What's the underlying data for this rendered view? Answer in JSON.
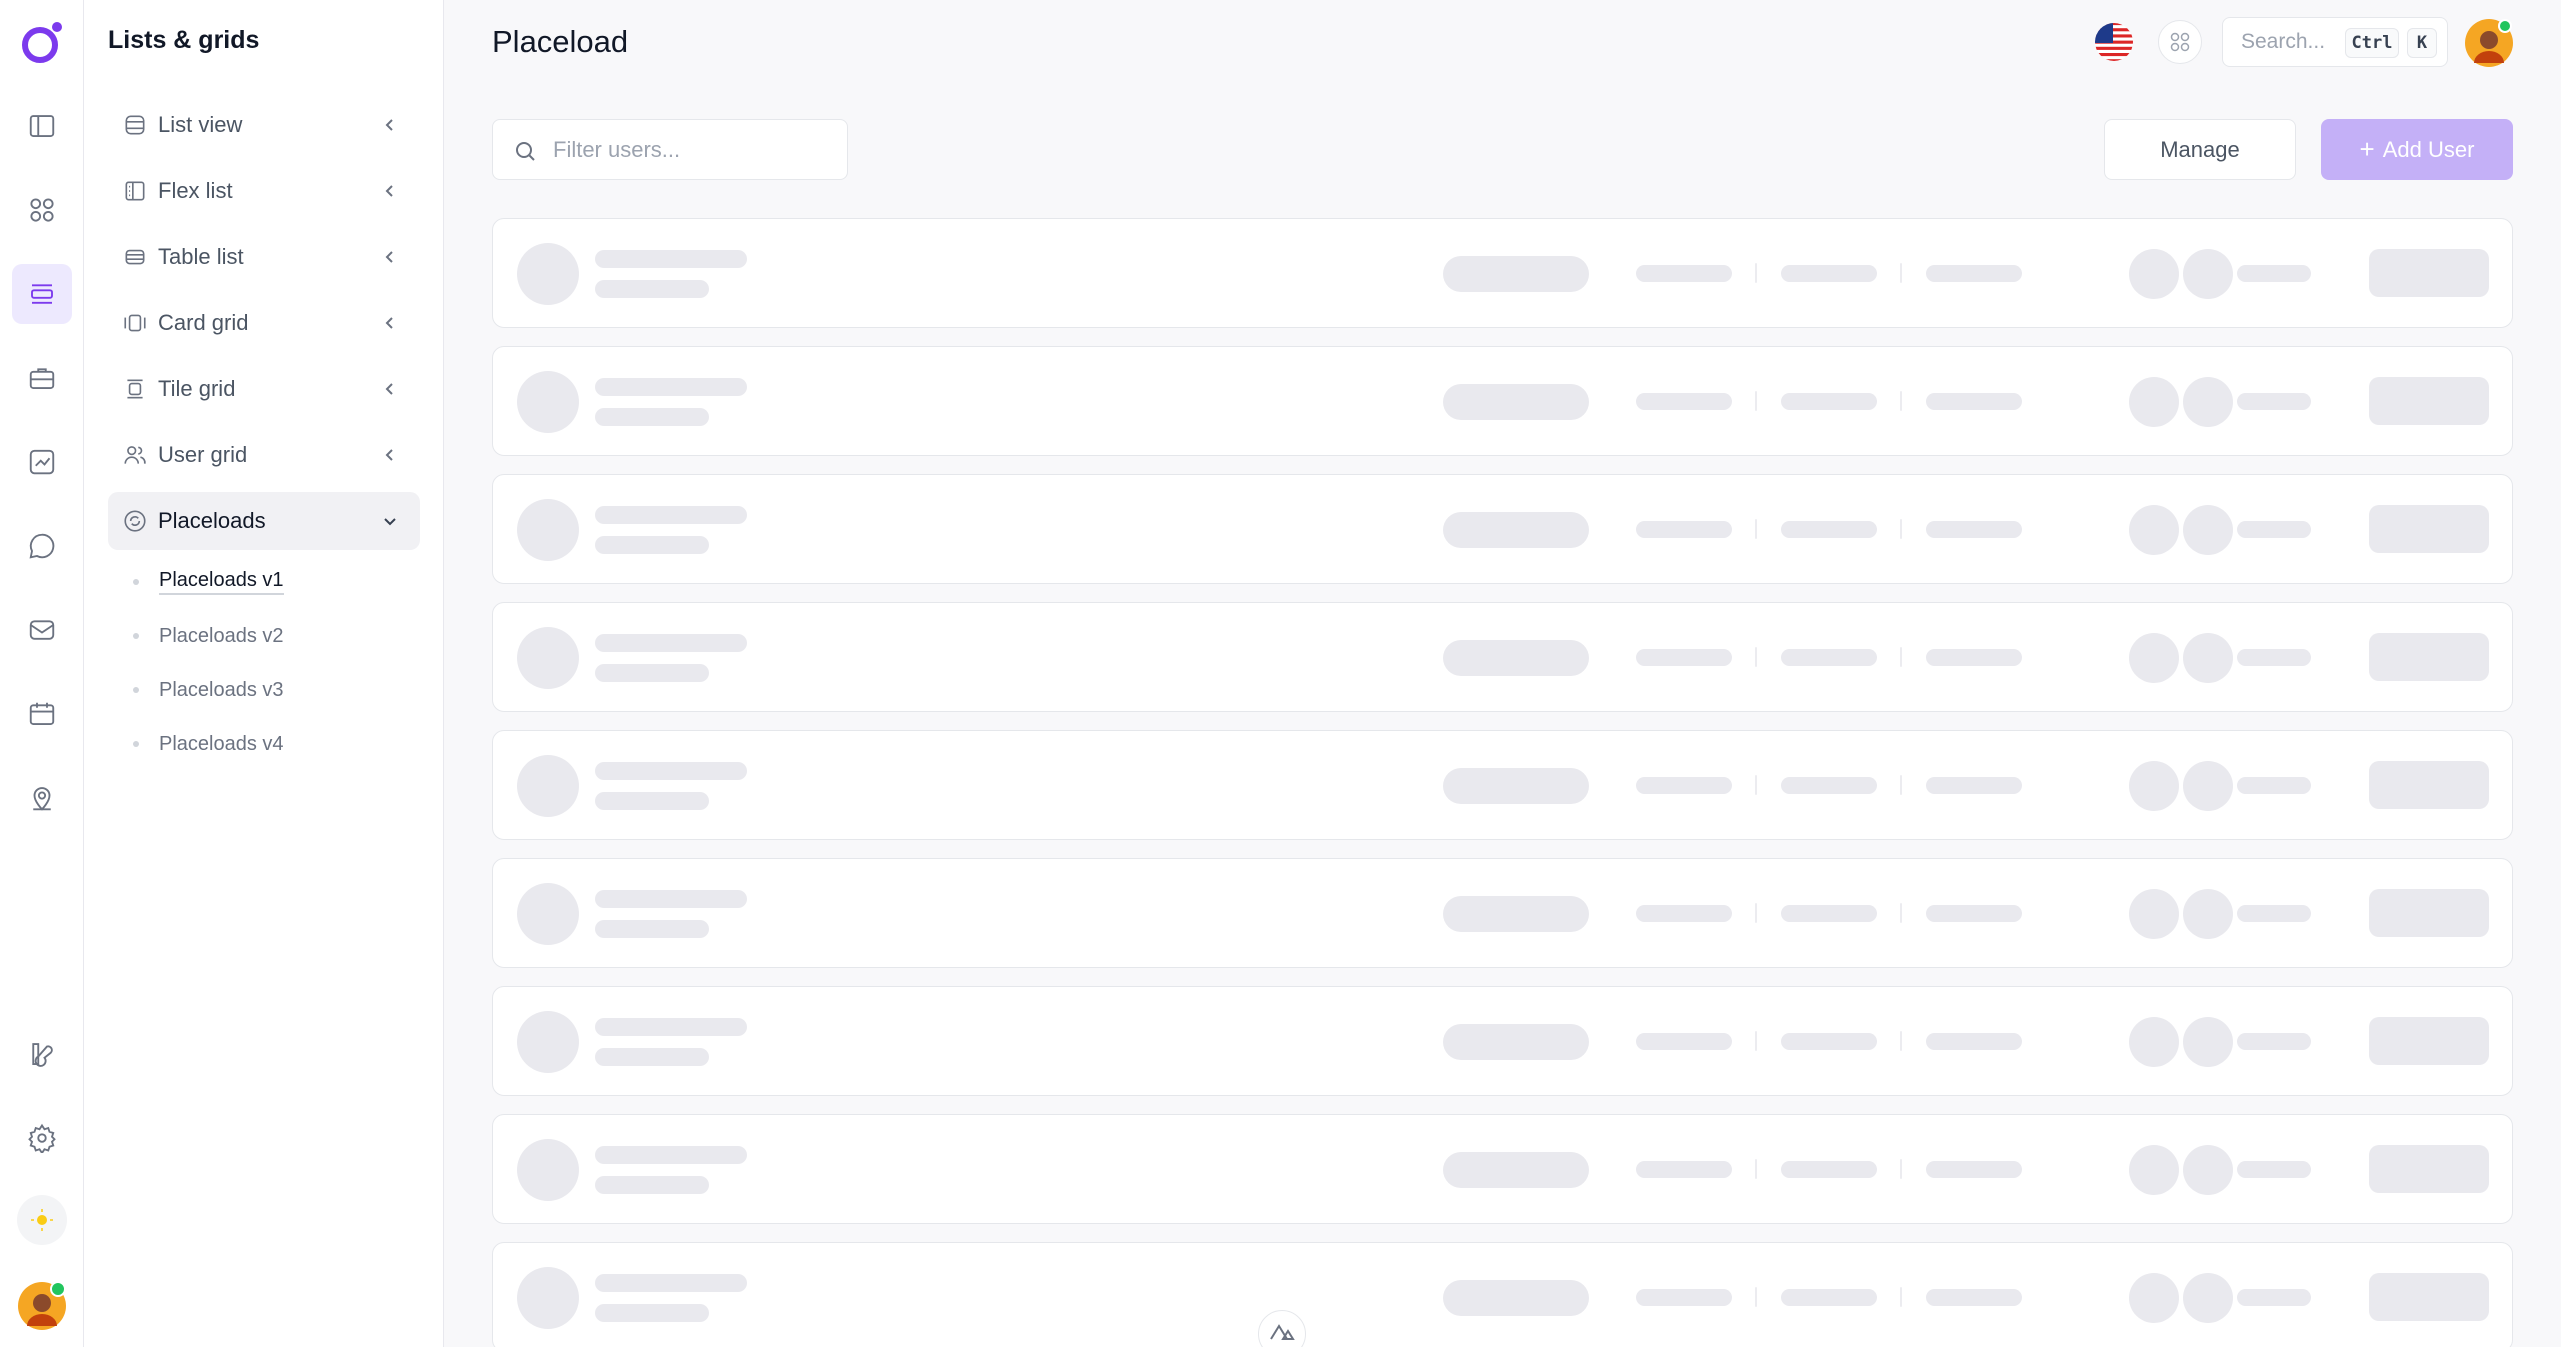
{
  "sidebar": {
    "title": "Lists & grids",
    "items": [
      {
        "label": "List view"
      },
      {
        "label": "Flex list"
      },
      {
        "label": "Table list"
      },
      {
        "label": "Card grid"
      },
      {
        "label": "Tile grid"
      },
      {
        "label": "User grid"
      },
      {
        "label": "Placeloads"
      }
    ],
    "subitems": [
      {
        "label": "Placeloads v1",
        "active": true
      },
      {
        "label": "Placeloads v2"
      },
      {
        "label": "Placeloads v3"
      },
      {
        "label": "Placeloads v4"
      }
    ]
  },
  "rail": {
    "icons": [
      "sidebar-panel-icon",
      "dashboard-grid-icon",
      "layout-list-icon",
      "briefcase-icon",
      "chart-icon",
      "chat-icon",
      "mail-icon",
      "calendar-icon",
      "map-pin-icon",
      "brand-icon",
      "settings-icon",
      "sun-icon"
    ]
  },
  "header": {
    "title": "Placeload",
    "search_placeholder": "Search...",
    "kbd_ctrl": "Ctrl",
    "kbd_k": "K"
  },
  "toolbar": {
    "filter_placeholder": "Filter users...",
    "manage_label": "Manage",
    "add_label": "Add User"
  },
  "colors": {
    "accent": "#7c3aed",
    "accent_light": "#c4b0f7",
    "placeholder": "#e9e9ee"
  },
  "list": {
    "placeholder_rows": 9
  }
}
